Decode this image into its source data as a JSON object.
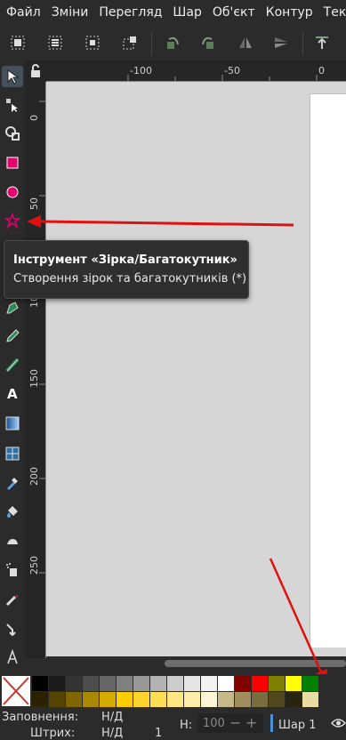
{
  "menu": [
    "Файл",
    "Зміни",
    "Перегляд",
    "Шар",
    "Об'єкт",
    "Контур",
    "Текс"
  ],
  "toolbar_icons": [
    "select-all-icon",
    "select-all-layers-icon",
    "deselect-icon",
    "select-same-icon",
    "rotate-ccw-icon",
    "rotate-cw-icon",
    "flip-horizontal-icon",
    "flip-vertical-icon",
    "raise-to-top-icon"
  ],
  "tools": [
    "selector-tool",
    "node-tool",
    "tweak-tool",
    "rectangle-tool",
    "ellipse-tool",
    "star-polygon-tool",
    "3d-box-tool",
    "spiral-tool",
    "pen-tool",
    "pencil-tool",
    "calligraphy-tool",
    "text-tool",
    "gradient-tool",
    "mesh-tool",
    "dropper-tool",
    "paint-bucket-tool",
    "eraser-tool",
    "spray-tool",
    "measure-tool",
    "connector-tool",
    "lpe-tool"
  ],
  "ruler": {
    "h_labels": [
      "-100",
      "-50",
      "0"
    ],
    "v_labels": [
      "0",
      "50",
      "100",
      "150",
      "200",
      "250"
    ]
  },
  "tooltip": {
    "title": "Інструмент «Зірка/Багатокутник»",
    "description": "Створення зірок та багатокутників (*)"
  },
  "palette": {
    "row1": [
      "#000000",
      "#1a1a1a",
      "#333333",
      "#4d4d4d",
      "#666666",
      "#808080",
      "#999999",
      "#b3b3b3",
      "#cccccc",
      "#e6e6e6",
      "#f2f2f2",
      "#ffffff",
      "#800000",
      "#ff0000",
      "#808000",
      "#ffff00",
      "#008000"
    ],
    "row2": [
      "#2b2200",
      "#554400",
      "#806600",
      "#aa8800",
      "#d4aa00",
      "#ffcc00",
      "#ffd42a",
      "#ffdd55",
      "#ffe680",
      "#ffeeaa",
      "#fff6d5",
      "#c8b98a",
      "#a08f5d",
      "#786d3f",
      "#504920",
      "#282410",
      "#e8dca0"
    ]
  },
  "status": {
    "fill_label": "Заповнення:",
    "fill_value": "Н/Д",
    "stroke_label": "Штрих:",
    "stroke_value": "Н/Д",
    "stroke_width": "1",
    "h_label": "Н:",
    "h_value": "100",
    "layer": "Шар 1"
  }
}
